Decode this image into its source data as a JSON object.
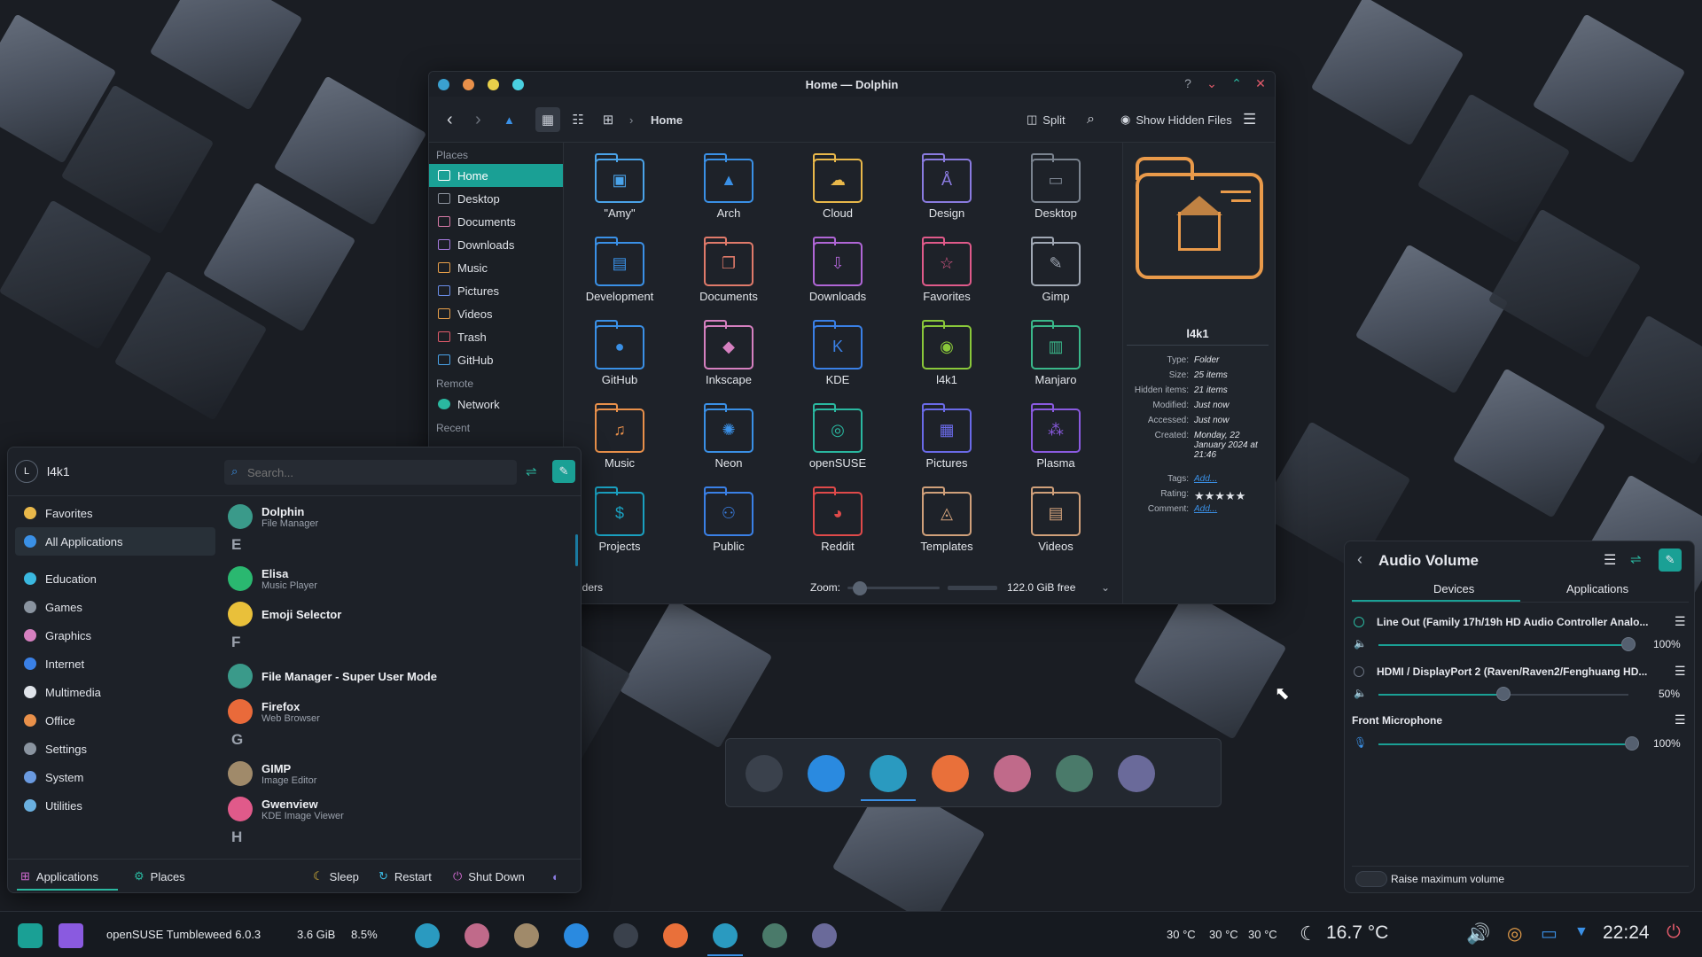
{
  "dolphin": {
    "title": "Home — Dolphin",
    "help": "?",
    "breadcrumb": "Home",
    "split_label": "Split",
    "hidden_files_label": "Show Hidden Files",
    "places_header": "Places",
    "remote_header": "Remote",
    "recent_header": "Recent",
    "places": [
      {
        "label": "Home",
        "color": "#ffffff"
      },
      {
        "label": "Desktop",
        "color": "#8f95a0"
      },
      {
        "label": "Documents",
        "color": "#d77aa7"
      },
      {
        "label": "Downloads",
        "color": "#a77be0"
      },
      {
        "label": "Music",
        "color": "#e9a04a"
      },
      {
        "label": "Pictures",
        "color": "#6a8de8"
      },
      {
        "label": "Videos",
        "color": "#e9a04a"
      },
      {
        "label": "Trash",
        "color": "#e05a6a"
      },
      {
        "label": "GitHub",
        "color": "#4aa3e9"
      }
    ],
    "remote": [
      {
        "label": "Network"
      }
    ],
    "folders": [
      {
        "label": "\"Amy\"",
        "color": "#4aa3e9",
        "glyph": "▣"
      },
      {
        "label": "Arch",
        "color": "#3a90e6",
        "glyph": "▲"
      },
      {
        "label": "Cloud",
        "color": "#e9b84a",
        "glyph": "☁"
      },
      {
        "label": "Design",
        "color": "#8a7be0",
        "glyph": "Å"
      },
      {
        "label": "Desktop",
        "color": "#7a838f",
        "glyph": "▭"
      },
      {
        "label": "Development",
        "color": "#3a90e6",
        "glyph": "▤"
      },
      {
        "label": "Documents",
        "color": "#e07a6a",
        "glyph": "❐"
      },
      {
        "label": "Downloads",
        "color": "#b066d6",
        "glyph": "⇩"
      },
      {
        "label": "Favorites",
        "color": "#e05a8a",
        "glyph": "☆"
      },
      {
        "label": "Gimp",
        "color": "#a0a8b4",
        "glyph": "✎"
      },
      {
        "label": "GitHub",
        "color": "#3a90e6",
        "glyph": "●"
      },
      {
        "label": "Inkscape",
        "color": "#d680c0",
        "glyph": "◆"
      },
      {
        "label": "KDE",
        "color": "#3a80e6",
        "glyph": "K"
      },
      {
        "label": "l4k1",
        "color": "#8ac83a",
        "glyph": "◉"
      },
      {
        "label": "Manjaro",
        "color": "#3ab88a",
        "glyph": "▥"
      },
      {
        "label": "Music",
        "color": "#e9904a",
        "glyph": "♫"
      },
      {
        "label": "Neon",
        "color": "#3a90e6",
        "glyph": "✺"
      },
      {
        "label": "openSUSE",
        "color": "#2ab8a0",
        "glyph": "◎"
      },
      {
        "label": "Pictures",
        "color": "#6a6ae8",
        "glyph": "▦"
      },
      {
        "label": "Plasma",
        "color": "#8a5ae0",
        "glyph": "⁂"
      },
      {
        "label": "Projects",
        "color": "#1aa0c0",
        "glyph": "$"
      },
      {
        "label": "Public",
        "color": "#3a80e6",
        "glyph": "⚇"
      },
      {
        "label": "Reddit",
        "color": "#e04a4a",
        "glyph": "◕"
      },
      {
        "label": "Templates",
        "color": "#d0a07a",
        "glyph": "◬"
      },
      {
        "label": "Videos",
        "color": "#d0a07a",
        "glyph": "▤"
      }
    ],
    "status_left": "folders",
    "zoom_label": "Zoom:",
    "free_space": "122.0 GiB free",
    "info": {
      "name": "l4k1",
      "rows": [
        {
          "k": "Type:",
          "v": "Folder"
        },
        {
          "k": "Size:",
          "v": "25 items"
        },
        {
          "k": "Hidden items:",
          "v": "21 items"
        },
        {
          "k": "Modified:",
          "v": "Just now"
        },
        {
          "k": "Accessed:",
          "v": "Just now"
        },
        {
          "k": "Created:",
          "v": "Monday, 22 January 2024 at 21:46"
        },
        {
          "k": "Tags:",
          "v": "Add..."
        },
        {
          "k": "Rating:",
          "v": "★★★★★"
        },
        {
          "k": "Comment:",
          "v": "Add..."
        }
      ]
    }
  },
  "launcher": {
    "user_initial": "L",
    "user": "l4k1",
    "search_placeholder": "Search...",
    "categories": [
      {
        "label": "Favorites",
        "color": "#e9b84a"
      },
      {
        "label": "All Applications",
        "color": "#3a90e6"
      },
      {
        "label": "Education",
        "color": "#3ab8e0"
      },
      {
        "label": "Games",
        "color": "#8a94a0"
      },
      {
        "label": "Graphics",
        "color": "#d680c0"
      },
      {
        "label": "Internet",
        "color": "#3a80e6"
      },
      {
        "label": "Multimedia",
        "color": "#e0e4ea"
      },
      {
        "label": "Office",
        "color": "#e9904a"
      },
      {
        "label": "Settings",
        "color": "#8a94a0"
      },
      {
        "label": "System",
        "color": "#6a9ae0"
      },
      {
        "label": "Utilities",
        "color": "#6ab0e0"
      }
    ],
    "apps": [
      {
        "name": "Dolphin",
        "sub": "File Manager",
        "color": "#3a9a8a"
      },
      {
        "name": "Elisa",
        "sub": "Music Player",
        "color": "#2ab870"
      },
      {
        "name": "Emoji Selector",
        "sub": "",
        "color": "#e9c03a"
      },
      {
        "name": "File Manager - Super User Mode",
        "sub": "",
        "color": "#3a9a8a"
      },
      {
        "name": "Firefox",
        "sub": "Web Browser",
        "color": "#e96a3a"
      },
      {
        "name": "GIMP",
        "sub": "Image Editor",
        "color": "#a08a6a"
      },
      {
        "name": "Gwenview",
        "sub": "KDE Image Viewer",
        "color": "#e05a8a"
      }
    ],
    "letters": [
      "E",
      "F",
      "G",
      "H"
    ],
    "footer": {
      "applications": "Applications",
      "places": "Places",
      "sleep": "Sleep",
      "restart": "Restart",
      "shutdown": "Shut Down"
    }
  },
  "audio": {
    "title": "Audio Volume",
    "tab_devices": "Devices",
    "tab_apps": "Applications",
    "devices": [
      {
        "name": "Line Out (Family 17h/19h HD Audio Controller Analo...",
        "volume": "100%",
        "level": 1.0
      },
      {
        "name": "HDMI / DisplayPort 2 (Raven/Raven2/Fenghuang HD...",
        "volume": "50%",
        "level": 0.5
      }
    ],
    "mic": {
      "name": "Front Microphone",
      "volume": "100%",
      "level": 1.0
    },
    "raise_label": "Raise maximum volume"
  },
  "taskbar": {
    "distro": "openSUSE Tumbleweed 6.0.3",
    "mem": "3.6 GiB",
    "cpu": "8.5%",
    "temps": [
      "30 °C",
      "30 °C",
      "30 °C"
    ],
    "weather": "16.7 °C",
    "clock": "22:24"
  }
}
